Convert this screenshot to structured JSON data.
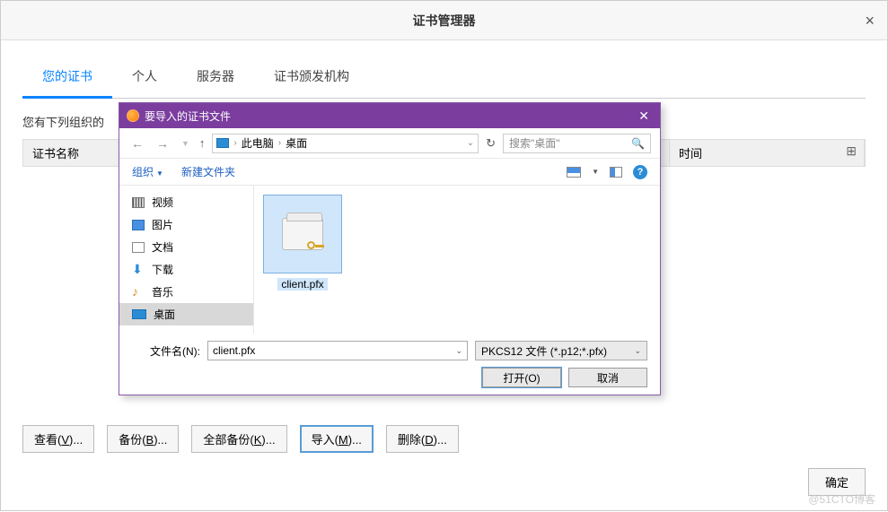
{
  "certmgr": {
    "title": "证书管理器",
    "tabs": [
      "您的证书",
      "个人",
      "服务器",
      "证书颁发机构"
    ],
    "desc_prefix": "您有下列组织的",
    "columns": {
      "name": "证书名称",
      "expire": "时间"
    },
    "buttons": {
      "view": {
        "pre": "查看(",
        "ul": "V",
        "post": ")..."
      },
      "backup": {
        "pre": "备份(",
        "ul": "B",
        "post": ")..."
      },
      "backup_all": {
        "pre": "全部备份(",
        "ul": "K",
        "post": ")..."
      },
      "import": {
        "pre": "导入(",
        "ul": "M",
        "post": ")..."
      },
      "delete": {
        "pre": "删除(",
        "ul": "D",
        "post": ")..."
      }
    },
    "ok": "确定"
  },
  "filepicker": {
    "title": "要导入的证书文件",
    "path": {
      "root": "此电脑",
      "folder": "桌面"
    },
    "search_placeholder": "搜索\"桌面\"",
    "toolbar": {
      "organize": "组织",
      "newfolder": "新建文件夹"
    },
    "sidebar": [
      "视频",
      "图片",
      "文档",
      "下载",
      "音乐",
      "桌面"
    ],
    "file": "client.pfx",
    "filename_label": "文件名(N):",
    "filename_value": "client.pfx",
    "filter": "PKCS12 文件 (*.p12;*.pfx)",
    "open": "打开(O)",
    "cancel": "取消"
  },
  "watermark": "@51CTO博客"
}
